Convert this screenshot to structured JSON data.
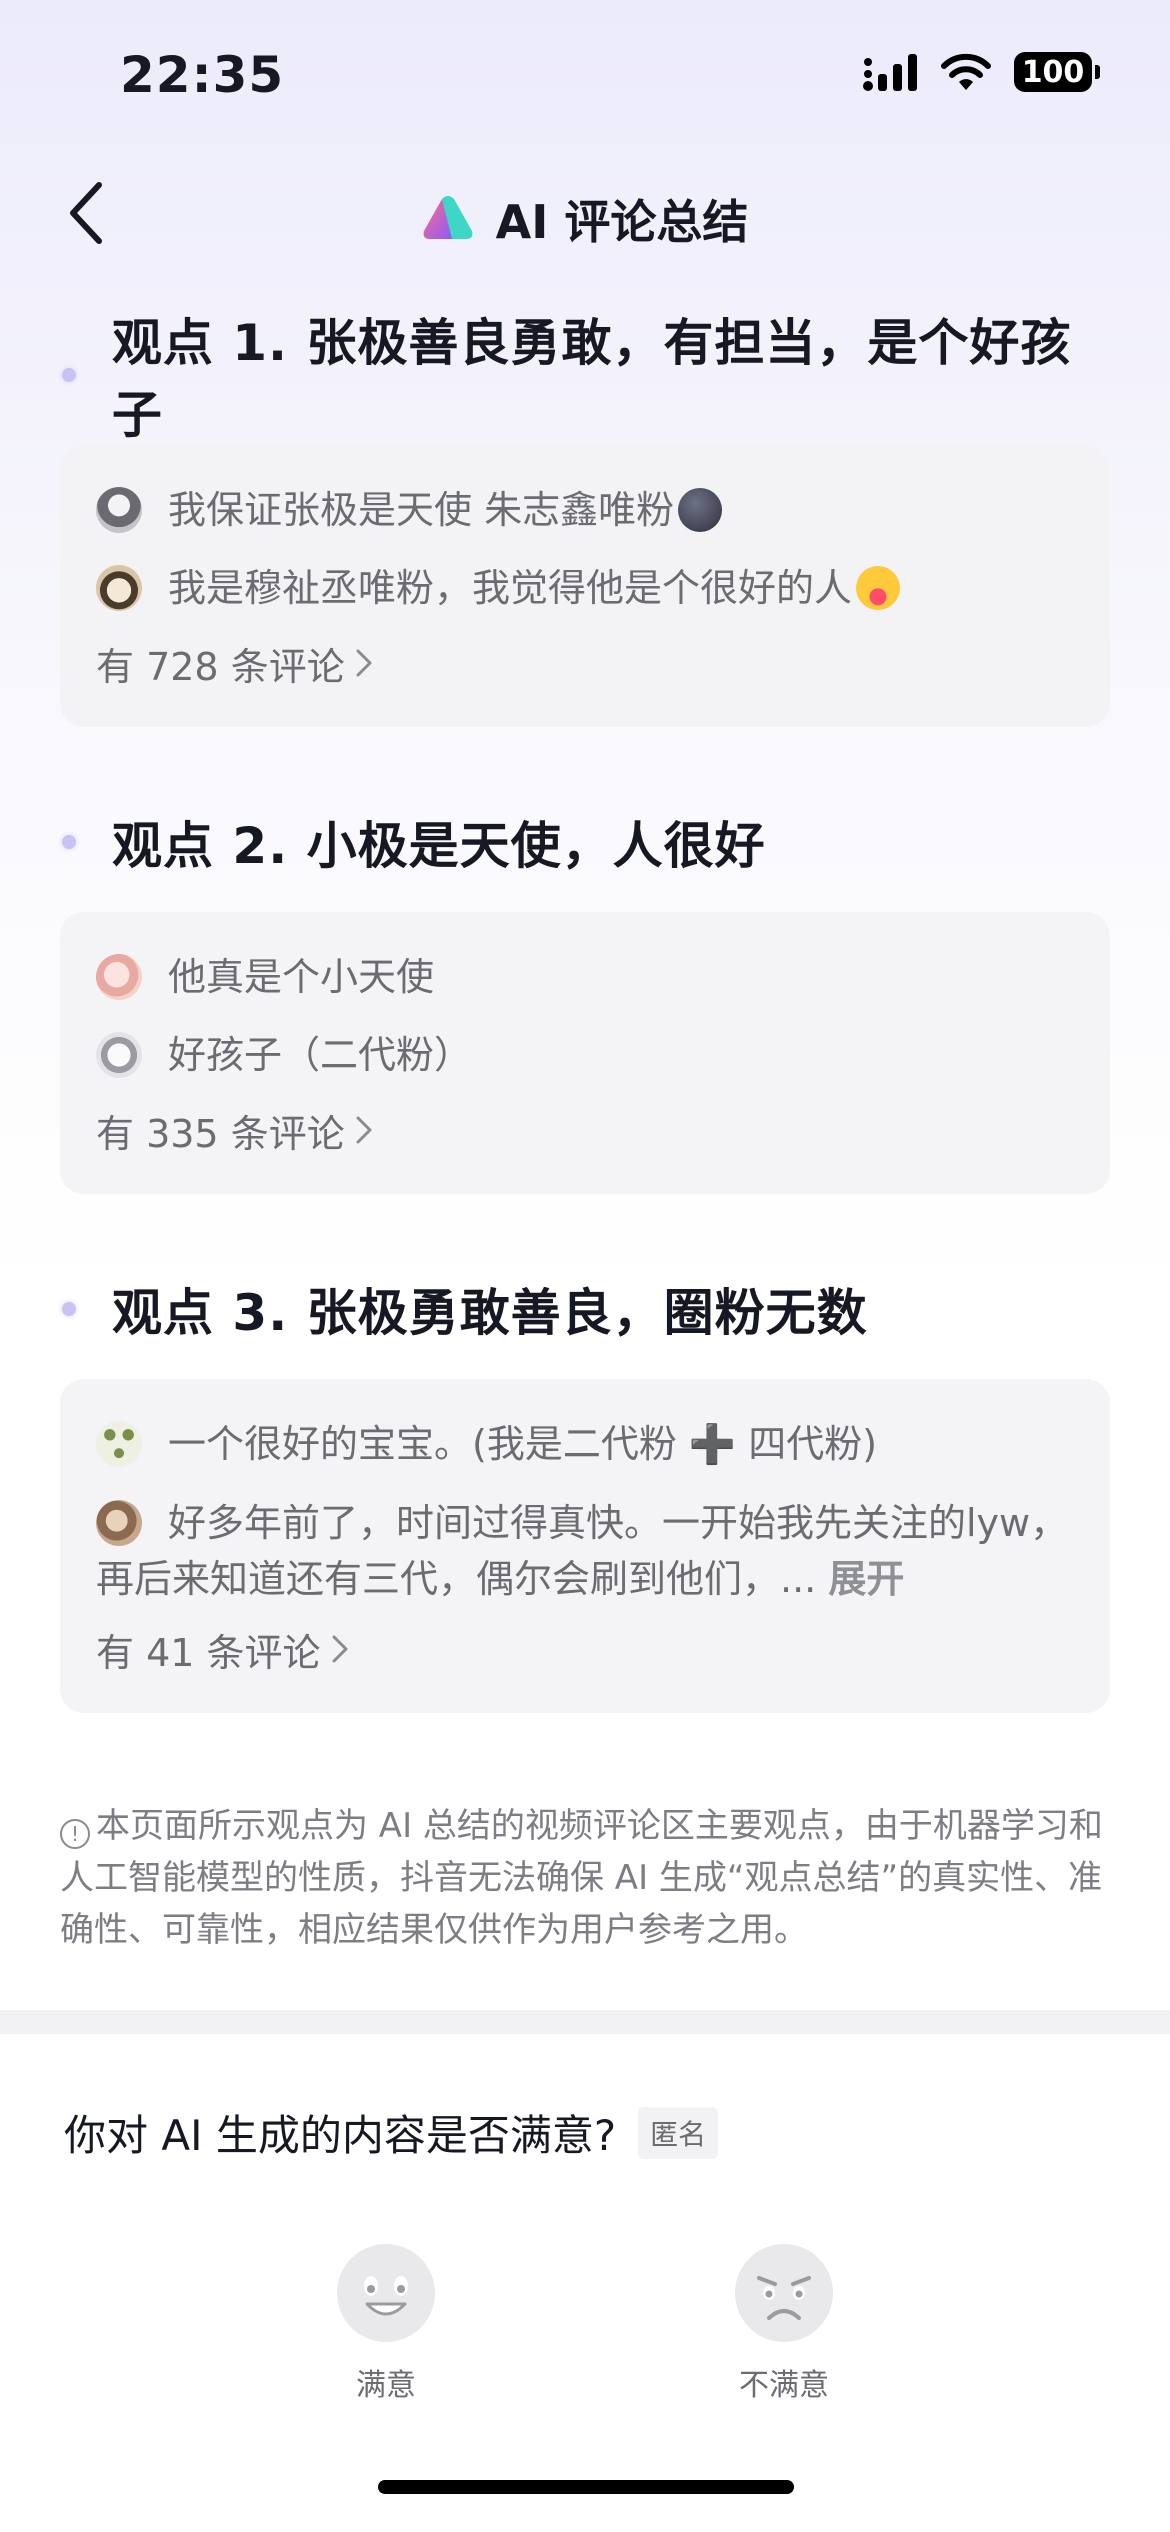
{
  "status_bar": {
    "time": "22:35",
    "battery": "100"
  },
  "header": {
    "title": "AI 评论总结"
  },
  "viewpoints": [
    {
      "title": "观点 1. 张极善良勇敢，有担当，是个好孩子",
      "comments": [
        "我保证张极是天使 朱志鑫唯粉",
        "我是穆祉丞唯粉，我觉得他是个很好的人"
      ],
      "count_label": "有 728 条评论"
    },
    {
      "title": "观点 2. 小极是天使，人很好",
      "comments": [
        "他真是个小天使",
        "好孩子（二代粉）"
      ],
      "count_label": "有 335 条评论"
    },
    {
      "title": "观点 3. 张极勇敢善良，圈粉无数",
      "comments": [
        "一个很好的宝宝。(我是二代粉 ➕ 四代粉)",
        "好多年前了，时间过得真快。一开始我先关注的lyw，再后来知道还有三代，偶尔会刷到他们，..."
      ],
      "expand_label": "展开",
      "count_label": "有 41 条评论"
    }
  ],
  "disclaimer": "本页面所示观点为 AI 总结的视频评论区主要观点，由于机器学习和人工智能模型的性质，抖音无法确保 AI 生成“观点总结”的真实性、准确性、可靠性，相应结果仅供作为用户参考之用。",
  "survey": {
    "question": "你对 AI 生成的内容是否满意?",
    "badge": "匿名",
    "options": [
      "满意",
      "不满意"
    ]
  },
  "colors": {
    "accent_purple": "#c9c3f5",
    "text_primary": "#161823",
    "text_secondary": "#6b6c72"
  },
  "icons": [
    "back-chevron-icon",
    "ai-logo-icon",
    "signal-icon",
    "wifi-icon",
    "battery-icon",
    "chevron-right-icon",
    "info-icon",
    "satisfied-face-icon",
    "unsatisfied-face-icon"
  ]
}
